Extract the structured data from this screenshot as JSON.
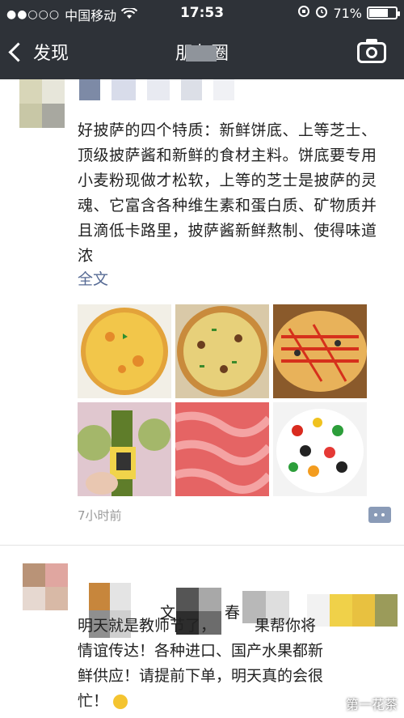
{
  "status_bar": {
    "signal": "●●○○○",
    "carrier": "中国移动",
    "time": "17:53",
    "battery": "71%",
    "battery_level": 0.71
  },
  "nav": {
    "back_label": "发现",
    "title": "朋友圈"
  },
  "post1": {
    "text": "好披萨的四个特质：新鲜饼底、上等芝士、顶级披萨酱和新鲜的食材主料。饼底要专用小麦粉现做才松软，上等的芝士是披萨的灵魂、它富含各种维生素和蛋白质、矿物质并且滴低卡路里，披萨酱新鲜熬制、使得味道浓",
    "full_text_link": "全文",
    "time": "7小时前",
    "photos": [
      {
        "icon": "pizza-photo-1"
      },
      {
        "icon": "pizza-photo-2"
      },
      {
        "icon": "pizza-photo-3"
      },
      {
        "icon": "olive-oil-photo"
      },
      {
        "icon": "meat-photo"
      },
      {
        "icon": "vegetables-photo"
      }
    ]
  },
  "post2": {
    "line1": "明天就是教师节了，",
    "line1b": "果帮你将",
    "line2a": "情谊传达！各种进口、",
    "line2b": "国产水果都新",
    "line3": "鲜供应！请提前下单，明天真的会很",
    "line4": "忙！",
    "partial_visible": "文",
    "partial_visible2": "春"
  },
  "watermark": "第一花茶"
}
